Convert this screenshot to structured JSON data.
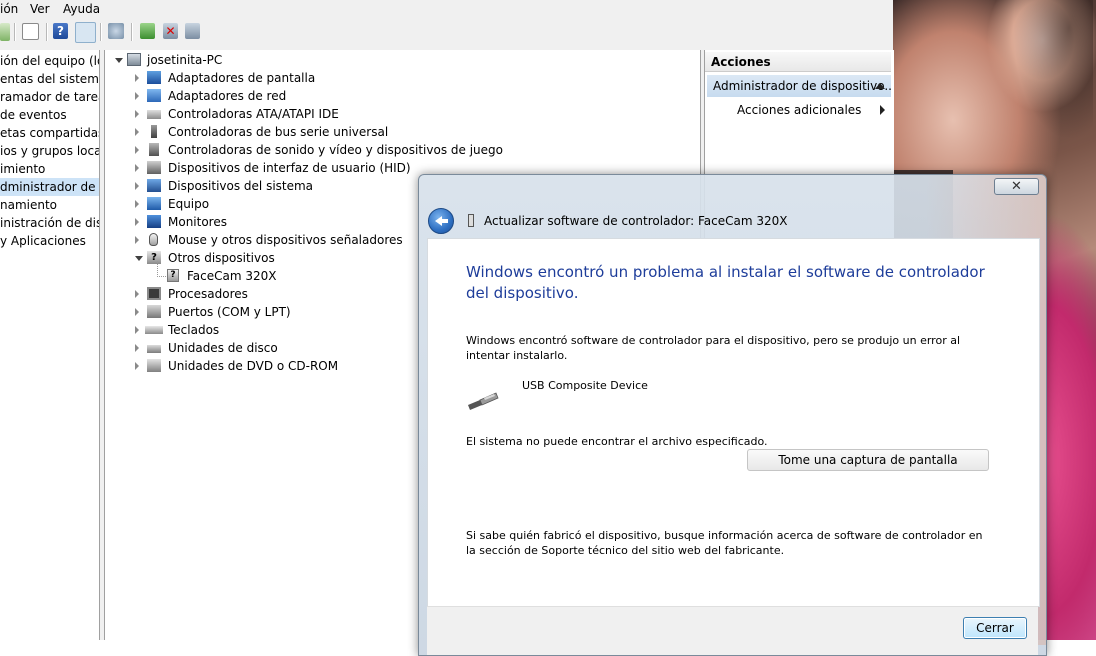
{
  "menu": {
    "items": [
      "ión",
      "Ver",
      "Ayuda"
    ]
  },
  "left_pane": {
    "items": [
      "ión del equipo (loc",
      "entas del sistema",
      "ramador de tareas",
      "de eventos",
      "etas compartidas",
      "ios y grupos locale",
      "imiento",
      "dministrador de dispo",
      "namiento",
      "inistración de disco",
      "y Aplicaciones"
    ],
    "selected_index": 7
  },
  "tree": {
    "root": "josetinita-PC",
    "categories": [
      "Adaptadores de pantalla",
      "Adaptadores de red",
      "Controladoras ATA/ATAPI IDE",
      "Controladoras de bus serie universal",
      "Controladoras de sonido y vídeo y dispositivos de juego",
      "Dispositivos de interfaz de usuario (HID)",
      "Dispositivos del sistema",
      "Equipo",
      "Monitores",
      "Mouse y otros dispositivos señaladores",
      "Otros dispositivos",
      "FaceCam 320X",
      "Procesadores",
      "Puertos (COM y LPT)",
      "Teclados",
      "Unidades de disco",
      "Unidades de DVD o CD-ROM"
    ]
  },
  "actions": {
    "header": "Acciones",
    "selected": "Administrador de dispositivo...",
    "more": "Acciones adicionales"
  },
  "dialog": {
    "close_glyph": "✕",
    "title": "Actualizar software de controlador: FaceCam 320X",
    "heading": "Windows encontró un problema al instalar el software de controlador del dispositivo.",
    "line1": "Windows encontró software de controlador para el dispositivo, pero se produjo un error al intentar instalarlo.",
    "device": "USB Composite Device",
    "error": "El sistema no puede encontrar el archivo especificado.",
    "capture_button": "Tome una captura de pantalla",
    "info": "Si sabe quién fabricó el dispositivo, busque información acerca de software de controlador en la sección de Soporte técnico del sitio web del fabricante.",
    "close_button": "Cerrar"
  },
  "colors": {
    "heading_blue": "#1e3d9a",
    "selection": "#cde3f7"
  }
}
